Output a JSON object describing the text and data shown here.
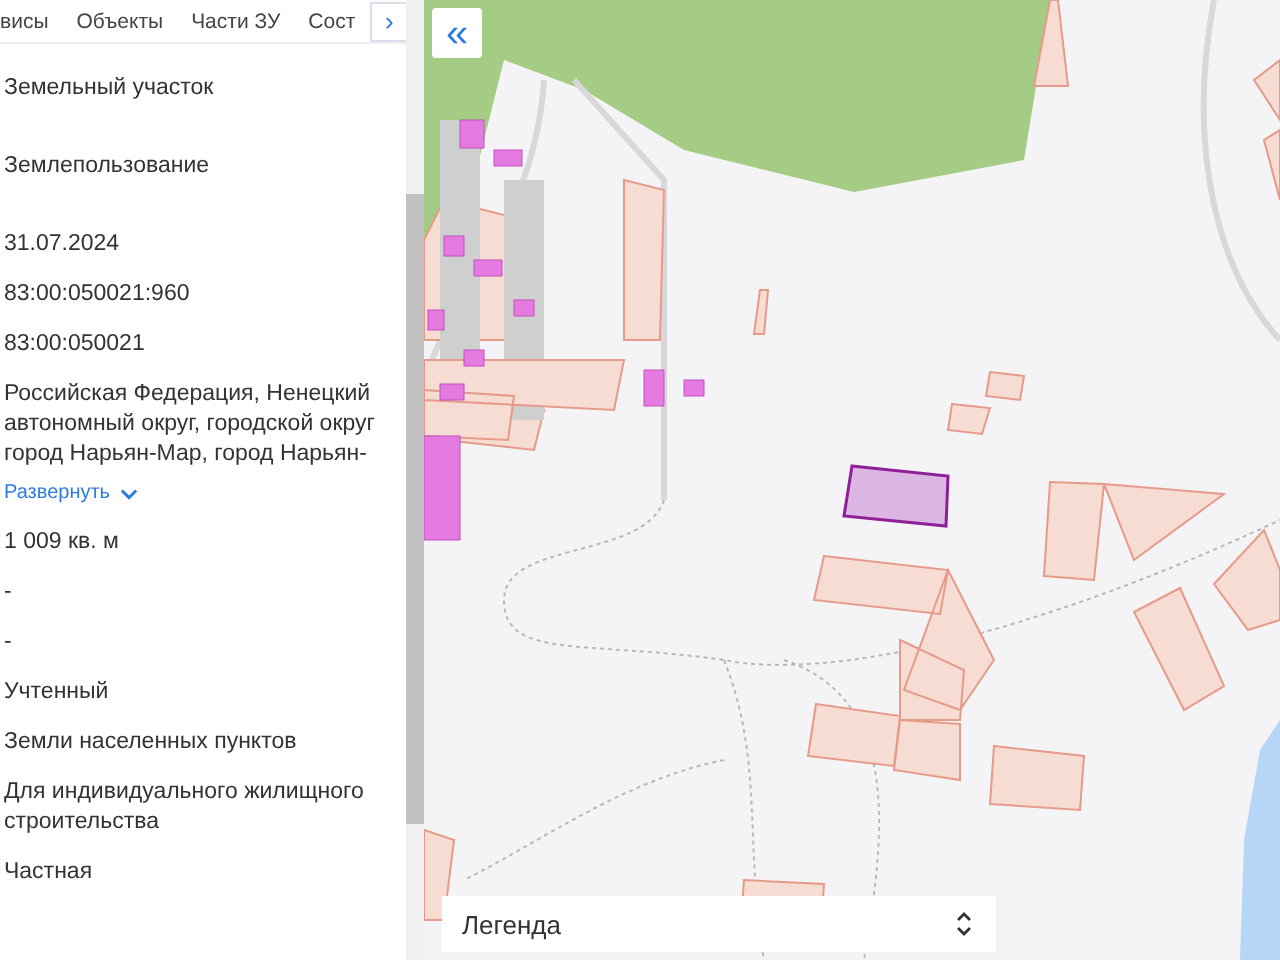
{
  "tabs": [
    {
      "label": "висы",
      "selected": false
    },
    {
      "label": "Объекты",
      "selected": false
    },
    {
      "label": "Части ЗУ",
      "selected": false
    },
    {
      "label": "Сост",
      "selected": false
    }
  ],
  "tabs_scroll_button": "›",
  "fields": [
    {
      "kind": "text",
      "value": "Земельный участок"
    },
    {
      "kind": "text",
      "value": "Землепользование"
    },
    {
      "kind": "text",
      "value": "31.07.2024"
    },
    {
      "kind": "text",
      "value": "83:00:050021:960"
    },
    {
      "kind": "text",
      "value": "83:00:050021"
    },
    {
      "kind": "address",
      "value": "Российская Федерация, Ненецкий автономный округ, городской округ город Нарьян-Мар, город Нарьян-",
      "link": "Развернуть"
    },
    {
      "kind": "text",
      "value": "1 009 кв. м"
    },
    {
      "kind": "text",
      "value": "-"
    },
    {
      "kind": "text",
      "value": "-"
    },
    {
      "kind": "text",
      "value": "Учтенный"
    },
    {
      "kind": "text",
      "value": "Земли населенных пунктов"
    },
    {
      "kind": "text",
      "value": "Для индивидуального жилищного строительства"
    },
    {
      "kind": "text",
      "value": "Частная"
    }
  ],
  "map": {
    "collapse_button": "«",
    "legend": {
      "title": "Легенда"
    }
  }
}
